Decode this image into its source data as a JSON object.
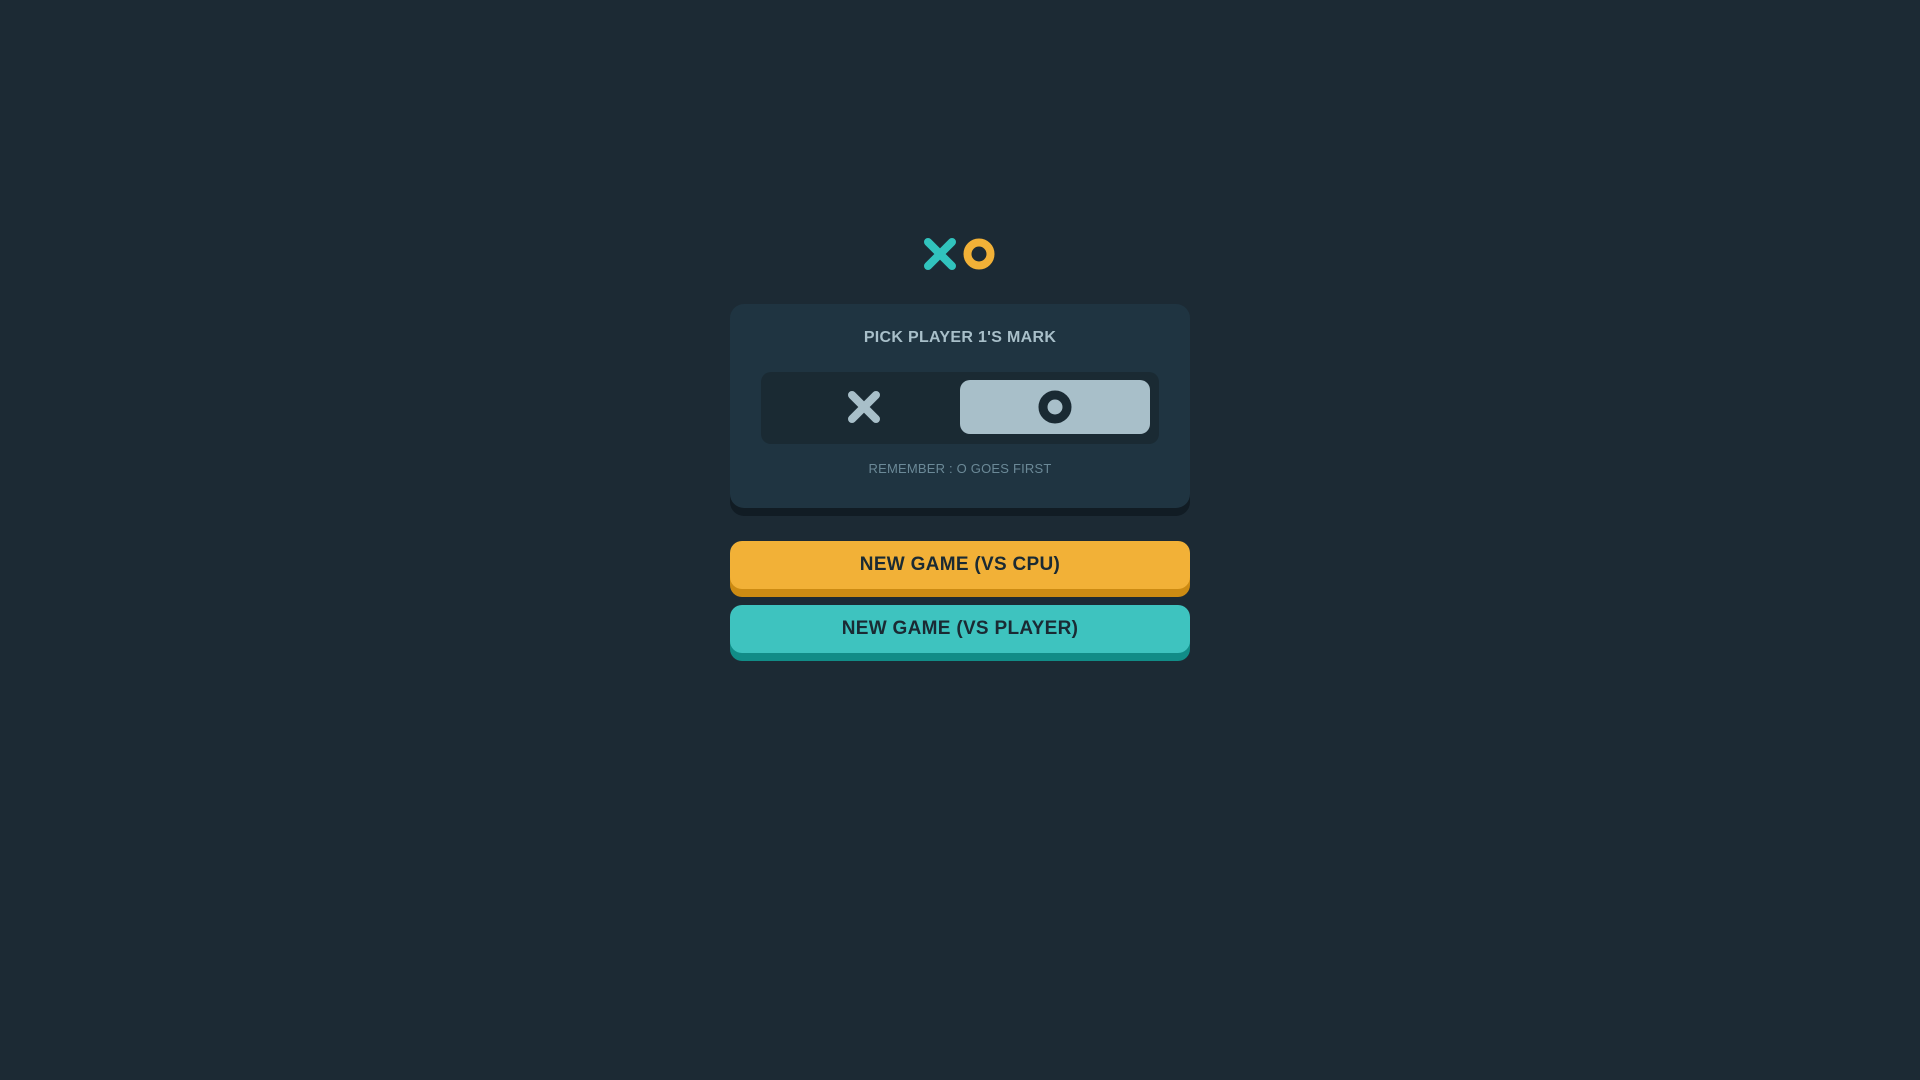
{
  "logo": {
    "x_icon": "x-mark-icon",
    "o_icon": "o-mark-icon",
    "x_color": "#31c3bd",
    "o_color": "#f2b137"
  },
  "mark_picker": {
    "title": "PICK PLAYER 1'S MARK",
    "options": [
      {
        "icon": "x-mark-icon",
        "selected": false
      },
      {
        "icon": "o-mark-icon",
        "selected": true
      }
    ],
    "hint": "REMEMBER : O GOES FIRST"
  },
  "buttons": {
    "vs_cpu": "NEW GAME (VS CPU)",
    "vs_player": "NEW GAME (VS PLAYER)"
  },
  "colors": {
    "background": "#1c2a34",
    "card": "#1f3441",
    "silver": "#a8bfc9",
    "yellow": "#f2b137",
    "teal": "#3ec3bf"
  }
}
